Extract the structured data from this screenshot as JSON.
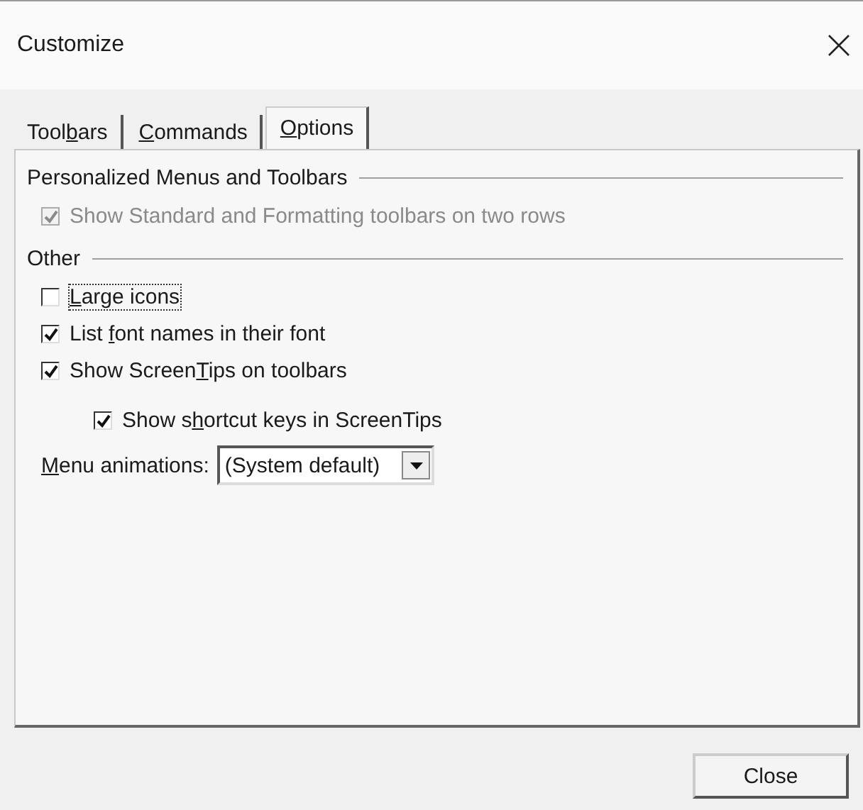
{
  "window": {
    "title": "Customize"
  },
  "tabs": [
    {
      "label": {
        "pre": "Tool",
        "key": "b",
        "post": "ars"
      },
      "selected": false
    },
    {
      "label": {
        "key": "C",
        "post": "ommands"
      },
      "selected": false
    },
    {
      "label": {
        "key": "O",
        "post": "ptions"
      },
      "selected": true
    }
  ],
  "groups": [
    {
      "title": "Personalized Menus and Toolbars",
      "items": [
        {
          "kind": "checkbox",
          "label": "Show Standard and Formatting toolbars on two rows",
          "checked": true,
          "disabled": true,
          "focused": false
        }
      ]
    },
    {
      "title": "Other",
      "items": [
        {
          "kind": "checkbox",
          "label": {
            "key": "L",
            "post": "arge icons"
          },
          "checked": false,
          "disabled": false,
          "focused": true
        },
        {
          "kind": "checkbox",
          "label": {
            "pre": "List ",
            "key": "f",
            "post": "ont names in their font"
          },
          "checked": true,
          "disabled": false,
          "focused": false
        },
        {
          "kind": "checkbox",
          "label": {
            "pre": "Show Screen",
            "key": "T",
            "post": "ips on toolbars"
          },
          "checked": true,
          "disabled": false,
          "focused": false,
          "children": [
            {
              "kind": "checkbox",
              "label": {
                "pre": "Show s",
                "key": "h",
                "post": "ortcut keys in ScreenTips"
              },
              "checked": true,
              "disabled": false,
              "focused": false
            }
          ]
        },
        {
          "kind": "dropdown",
          "label": {
            "key": "M",
            "post": "enu animations:"
          },
          "value": "(System default)"
        }
      ]
    }
  ],
  "buttons": [
    {
      "label": "Close"
    }
  ]
}
